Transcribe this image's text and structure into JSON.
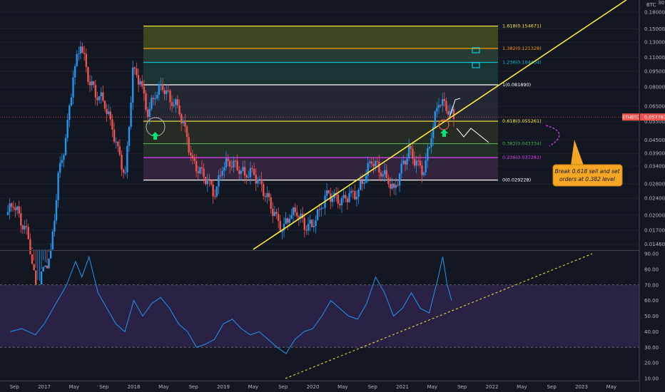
{
  "header": {
    "currency": "BTC",
    "scale_label": "30"
  },
  "chart_data": [
    {
      "type": "candlestick",
      "symbol": "ETHBTC",
      "last_price": "0.057787",
      "scale": "log",
      "ylim": [
        0.0138,
        0.205
      ],
      "price_ticks": [
        "0.180000",
        "0.150000",
        "0.130000",
        "0.110000",
        "0.095000",
        "0.080000",
        "0.065000",
        "0.055000",
        "0.045000",
        "0.039000",
        "0.034000",
        "0.028000",
        "0.024000",
        "0.020000",
        "0.017000",
        "0.014600"
      ],
      "time_ticks": [
        "Sep",
        "2017",
        "May",
        "Sep",
        "2018",
        "May",
        "Sep",
        "2019",
        "May",
        "Sep",
        "2020",
        "May",
        "Sep",
        "2021",
        "May",
        "Sep",
        "2022",
        "May",
        "Sep",
        "2023",
        "May",
        "Se"
      ],
      "price_path": [
        [
          "2016-08",
          0.02
        ],
        [
          "2016-09",
          0.023
        ],
        [
          "2016-10",
          0.019
        ],
        [
          "2016-11",
          0.016
        ],
        [
          "2016-12",
          0.009
        ],
        [
          "2017-01",
          0.011
        ],
        [
          "2017-02",
          0.013
        ],
        [
          "2017-03",
          0.03
        ],
        [
          "2017-04",
          0.045
        ],
        [
          "2017-05",
          0.09
        ],
        [
          "2017-06",
          0.13
        ],
        [
          "2017-07",
          0.09
        ],
        [
          "2017-08",
          0.075
        ],
        [
          "2017-09",
          0.07
        ],
        [
          "2017-10",
          0.055
        ],
        [
          "2017-11",
          0.04
        ],
        [
          "2017-12",
          0.03
        ],
        [
          "2018-01",
          0.095
        ],
        [
          "2018-02",
          0.085
        ],
        [
          "2018-03",
          0.06
        ],
        [
          "2018-04",
          0.075
        ],
        [
          "2018-05",
          0.082
        ],
        [
          "2018-06",
          0.07
        ],
        [
          "2018-07",
          0.065
        ],
        [
          "2018-08",
          0.05
        ],
        [
          "2018-09",
          0.035
        ],
        [
          "2018-10",
          0.032
        ],
        [
          "2018-11",
          0.029
        ],
        [
          "2018-12",
          0.025
        ],
        [
          "2019-01",
          0.034
        ],
        [
          "2019-02",
          0.036
        ],
        [
          "2019-03",
          0.034
        ],
        [
          "2019-04",
          0.031
        ],
        [
          "2019-05",
          0.032
        ],
        [
          "2019-06",
          0.028
        ],
        [
          "2019-07",
          0.024
        ],
        [
          "2019-08",
          0.02
        ],
        [
          "2019-09",
          0.017
        ],
        [
          "2019-10",
          0.02
        ],
        [
          "2019-11",
          0.021
        ],
        [
          "2019-12",
          0.018
        ],
        [
          "2020-01",
          0.018
        ],
        [
          "2020-02",
          0.021
        ],
        [
          "2020-03",
          0.025
        ],
        [
          "2020-04",
          0.024
        ],
        [
          "2020-05",
          0.023
        ],
        [
          "2020-06",
          0.025
        ],
        [
          "2020-07",
          0.025
        ],
        [
          "2020-08",
          0.03
        ],
        [
          "2020-09",
          0.037
        ],
        [
          "2020-10",
          0.033
        ],
        [
          "2020-11",
          0.03
        ],
        [
          "2020-12",
          0.026
        ],
        [
          "2021-01",
          0.033
        ],
        [
          "2021-02",
          0.04
        ],
        [
          "2021-03",
          0.035
        ],
        [
          "2021-04",
          0.032
        ],
        [
          "2021-05",
          0.048
        ],
        [
          "2021-06",
          0.07
        ],
        [
          "2021-07",
          0.065
        ],
        [
          "2021-08",
          0.057787
        ]
      ],
      "fib_levels": [
        {
          "label": "1.618(0.154671)",
          "value": 0.154671,
          "color": "#ffeb3b"
        },
        {
          "label": "1.382(0.121328)",
          "value": 0.121328,
          "color": "#ff9800"
        },
        {
          "label": "1.236(0.104404)",
          "value": 0.104404,
          "color": "#00bcd4"
        },
        {
          "label": "1(0.081890)",
          "value": 0.08189,
          "color": "#ffffff"
        },
        {
          "label": "0.618(0.055261)",
          "value": 0.055261,
          "color": "#ffeb3b"
        },
        {
          "label": "0.382(0.043334)",
          "value": 0.043334,
          "color": "#4caf50"
        },
        {
          "label": "0.236(0.037281)",
          "value": 0.037281,
          "color": "#e040fb"
        },
        {
          "label": "0(0.029228)",
          "value": 0.029228,
          "color": "#ffffff"
        }
      ],
      "trendline": {
        "from": [
          "2019-05",
          0.0138
        ],
        "to": [
          "2023-07",
          0.205
        ],
        "color": "#ffeb3b"
      },
      "annotation": {
        "text_lines": [
          "Break 0.618 sell and set",
          "orders at 0.382 level"
        ],
        "bg": "#f5a623"
      },
      "colors": {
        "up": "#2196f3",
        "down": "#ef5350",
        "accent": "#ffeb3b"
      }
    },
    {
      "type": "line",
      "name": "RSI",
      "ylim": [
        10,
        90
      ],
      "ticks": [
        "90.00",
        "80.00",
        "70.00",
        "60.00",
        "50.00",
        "40.00",
        "30.00",
        "20.00",
        "10.00"
      ],
      "band": [
        30,
        70
      ],
      "values": [
        [
          40,
          2016.62
        ],
        [
          42,
          2016.75
        ],
        [
          38,
          2016.9
        ],
        [
          45,
          2017.0
        ],
        [
          55,
          2017.1
        ],
        [
          70,
          2017.25
        ],
        [
          85,
          2017.35
        ],
        [
          75,
          2017.42
        ],
        [
          88,
          2017.5
        ],
        [
          65,
          2017.6
        ],
        [
          55,
          2017.7
        ],
        [
          45,
          2017.8
        ],
        [
          40,
          2017.9
        ],
        [
          60,
          2018.0
        ],
        [
          50,
          2018.1
        ],
        [
          58,
          2018.2
        ],
        [
          62,
          2018.3
        ],
        [
          55,
          2018.4
        ],
        [
          45,
          2018.5
        ],
        [
          40,
          2018.6
        ],
        [
          30,
          2018.7
        ],
        [
          32,
          2018.8
        ],
        [
          35,
          2018.9
        ],
        [
          45,
          2019.0
        ],
        [
          48,
          2019.1
        ],
        [
          42,
          2019.2
        ],
        [
          38,
          2019.3
        ],
        [
          40,
          2019.4
        ],
        [
          35,
          2019.5
        ],
        [
          30,
          2019.6
        ],
        [
          26,
          2019.7
        ],
        [
          35,
          2019.8
        ],
        [
          40,
          2019.9
        ],
        [
          42,
          2020.0
        ],
        [
          50,
          2020.1
        ],
        [
          60,
          2020.2
        ],
        [
          55,
          2020.3
        ],
        [
          50,
          2020.4
        ],
        [
          48,
          2020.5
        ],
        [
          58,
          2020.6
        ],
        [
          75,
          2020.7
        ],
        [
          65,
          2020.8
        ],
        [
          50,
          2020.9
        ],
        [
          55,
          2021.0
        ],
        [
          65,
          2021.1
        ],
        [
          55,
          2021.2
        ],
        [
          52,
          2021.3
        ],
        [
          75,
          2021.4
        ],
        [
          88,
          2021.45
        ],
        [
          70,
          2021.5
        ],
        [
          60,
          2021.55
        ]
      ],
      "trendline_color": "#ffeb3b",
      "color": "#2196f3"
    }
  ]
}
